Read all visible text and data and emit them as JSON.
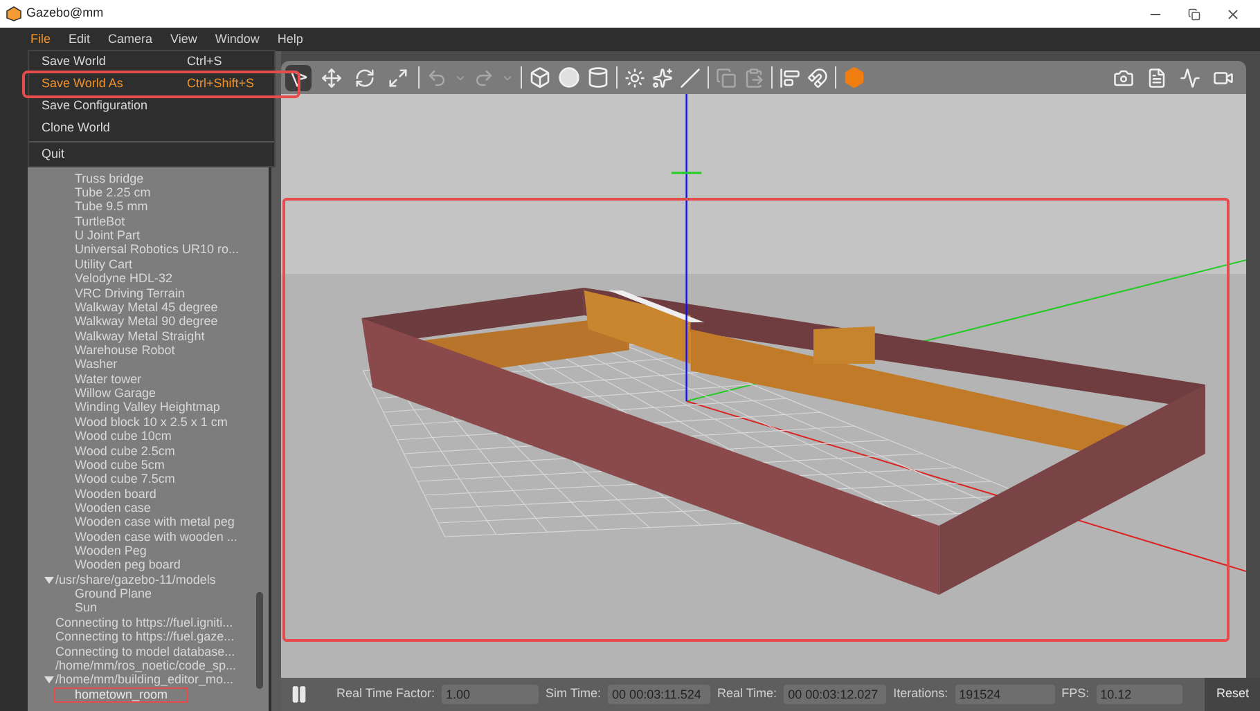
{
  "window": {
    "title": "Gazebo@mm"
  },
  "menu_bar": [
    {
      "label": "File",
      "selected": true
    },
    {
      "label": "Edit",
      "selected": false
    },
    {
      "label": "Camera",
      "selected": false
    },
    {
      "label": "View",
      "selected": false
    },
    {
      "label": "Window",
      "selected": false
    },
    {
      "label": "Help",
      "selected": false
    }
  ],
  "file_menu": [
    {
      "kind": "item",
      "label": "Save World",
      "shortcut": "Ctrl+S",
      "selected": false
    },
    {
      "kind": "item",
      "label": "Save World As",
      "shortcut": "Ctrl+Shift+S",
      "selected": true
    },
    {
      "kind": "item",
      "label": "Save Configuration",
      "selected": false
    },
    {
      "kind": "item",
      "label": "Clone World",
      "selected": false
    },
    {
      "kind": "separator"
    },
    {
      "kind": "item",
      "label": "Quit",
      "selected": false
    }
  ],
  "model_tree": [
    {
      "children": [
        {
          "label": "Truss bridge"
        },
        {
          "label": "Tube 2.25 cm"
        },
        {
          "label": "Tube 9.5 mm"
        },
        {
          "label": "TurtleBot"
        },
        {
          "label": "U Joint Part"
        },
        {
          "label": "Universal Robotics UR10 ro..."
        },
        {
          "label": "Utility Cart"
        },
        {
          "label": "Velodyne HDL-32"
        },
        {
          "label": "VRC Driving Terrain"
        },
        {
          "label": "Walkway Metal 45 degree"
        },
        {
          "label": "Walkway Metal 90 degree"
        },
        {
          "label": "Walkway Metal Straight"
        },
        {
          "label": "Warehouse Robot"
        },
        {
          "label": "Washer"
        },
        {
          "label": "Water tower"
        },
        {
          "label": "Willow Garage"
        },
        {
          "label": "Winding Valley Heightmap"
        },
        {
          "label": "Wood block 10 x 2.5 x 1 cm"
        },
        {
          "label": "Wood cube 10cm"
        },
        {
          "label": "Wood cube 2.5cm"
        },
        {
          "label": "Wood cube 5cm"
        },
        {
          "label": "Wood cube 7.5cm"
        },
        {
          "label": "Wooden board"
        },
        {
          "label": "Wooden case"
        },
        {
          "label": "Wooden case with metal peg"
        },
        {
          "label": "Wooden case with wooden ..."
        },
        {
          "label": "Wooden Peg"
        },
        {
          "label": "Wooden peg board"
        }
      ]
    },
    {
      "label": "/usr/share/gazebo-11/models",
      "expanded": true,
      "children": [
        {
          "label": "Ground Plane"
        },
        {
          "label": "Sun"
        }
      ]
    },
    {
      "label": "Connecting to https://fuel.igniti..."
    },
    {
      "label": "Connecting to https://fuel.gaze..."
    },
    {
      "label": "Connecting to model database..."
    },
    {
      "label": "/home/mm/ros_noetic/code_sp..."
    },
    {
      "label": "/home/mm/building_editor_mo...",
      "expanded": true,
      "children": [
        {
          "label": "hometown_room",
          "selected": true
        }
      ]
    }
  ],
  "status_bar": {
    "paused": false,
    "fields": [
      {
        "label": "Real Time Factor:",
        "value": "1.00"
      },
      {
        "label": "Sim Time:",
        "value": "00 00:03:11.524"
      },
      {
        "label": "Real Time:",
        "value": "00 00:03:12.027"
      },
      {
        "label": "Iterations:",
        "value": "191524"
      },
      {
        "label": "FPS:",
        "value": "10.12"
      }
    ],
    "reset": "Reset"
  }
}
